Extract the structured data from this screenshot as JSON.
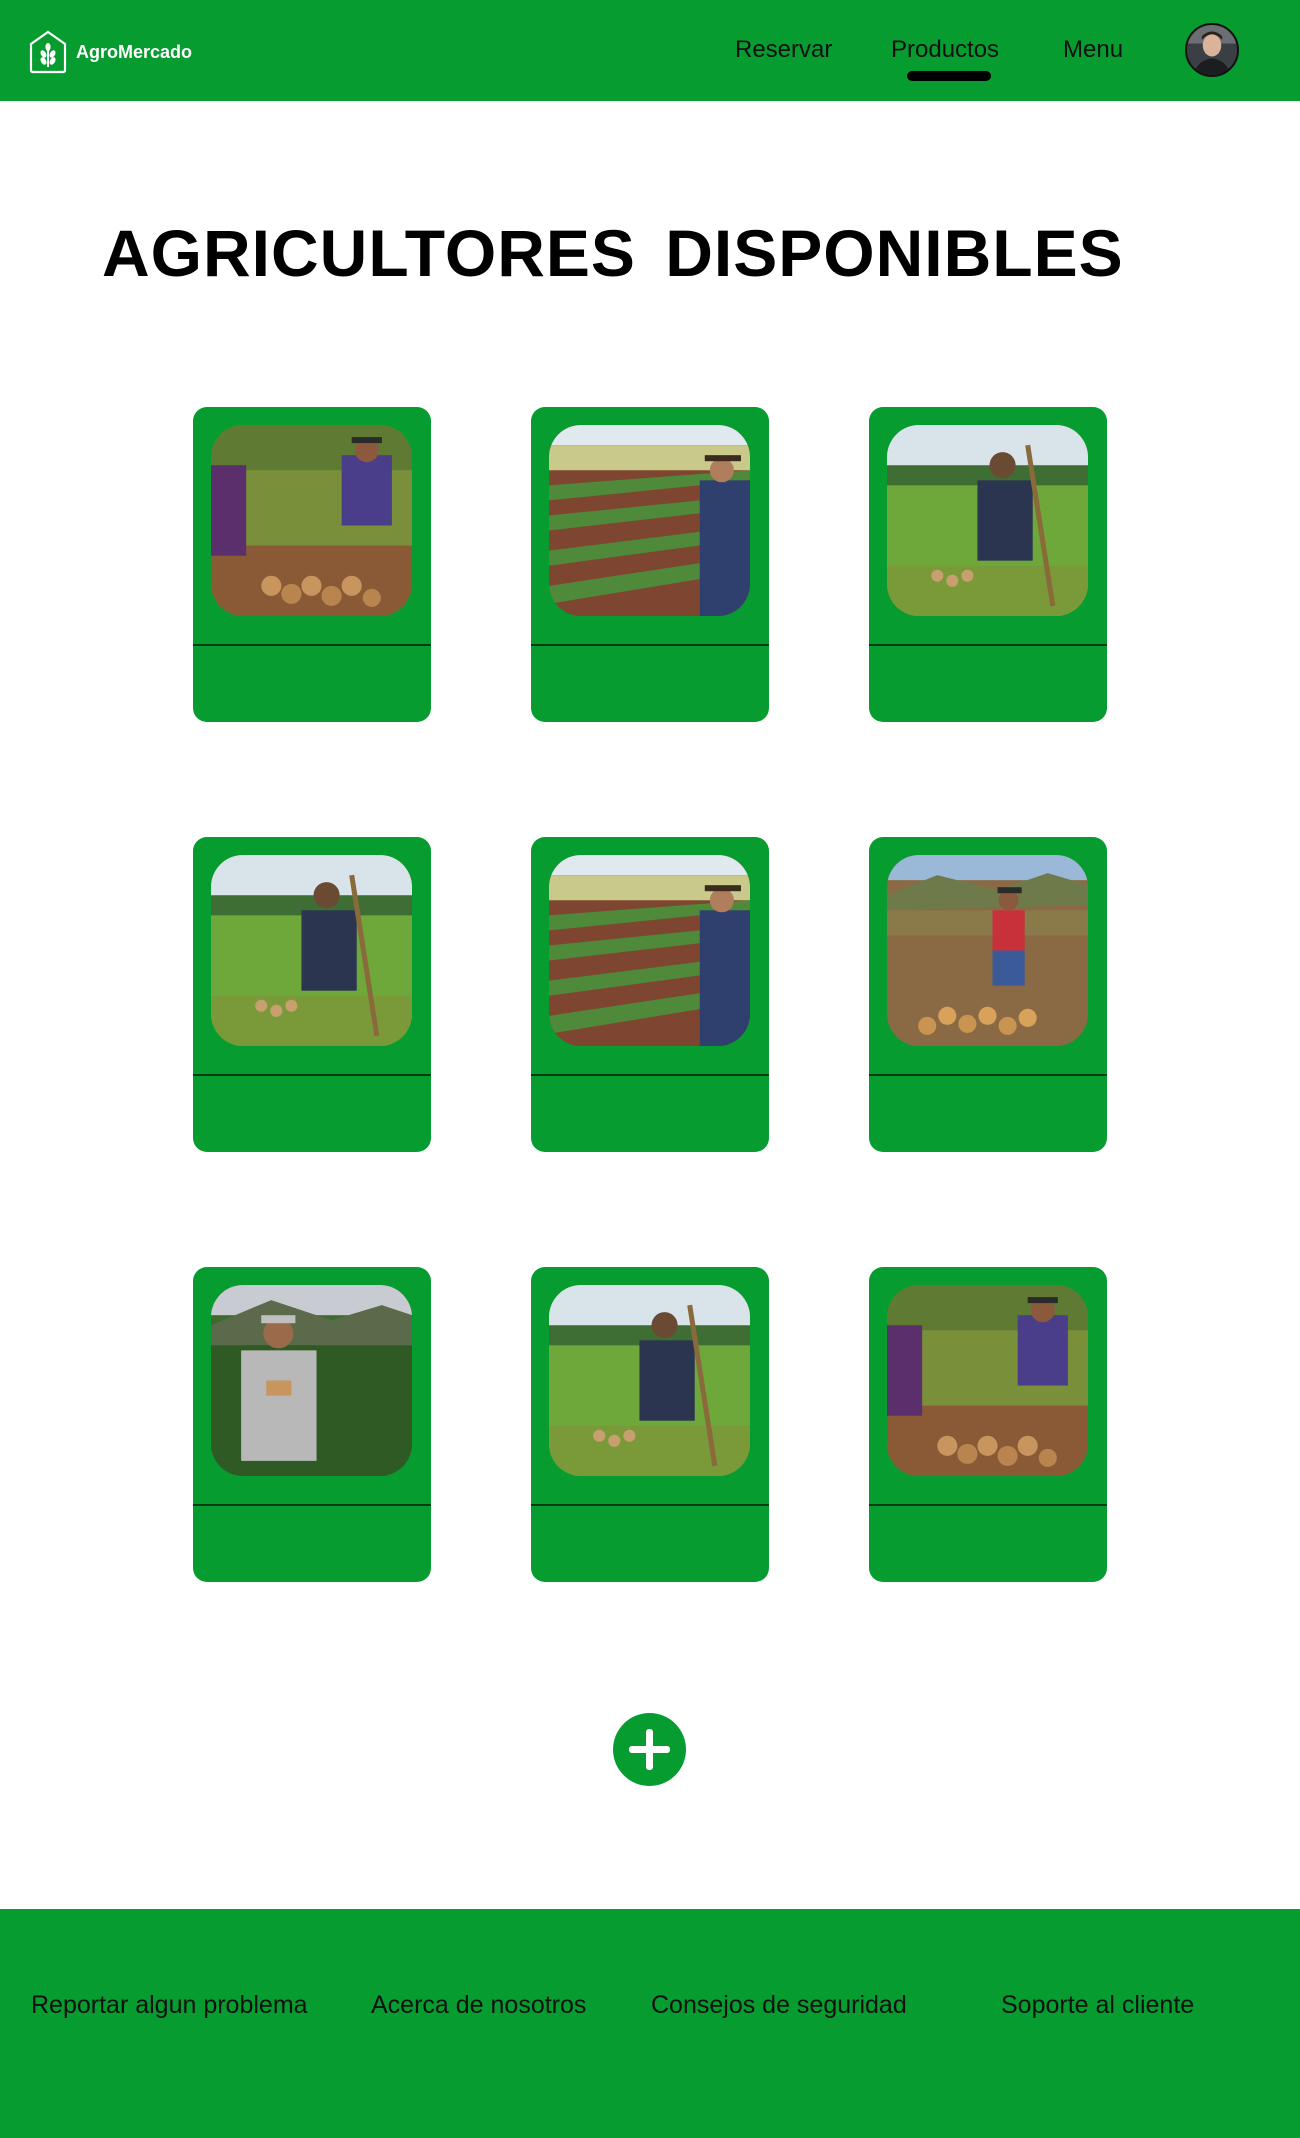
{
  "app": {
    "name": "AgroMercado",
    "logo_icon": "wheat-house-logo-icon"
  },
  "colors": {
    "brand_green": "#069c2f",
    "text": "#000000",
    "background": "#ffffff"
  },
  "nav": {
    "items": [
      {
        "label": "Reservar",
        "active": false
      },
      {
        "label": "Productos",
        "active": true
      },
      {
        "label": "Menu",
        "active": false
      }
    ],
    "avatar_icon": "user-avatar-icon"
  },
  "page": {
    "title": "AGRICULTORES DISPONIBLES"
  },
  "farmers": [
    {
      "photo": "farmers-harvesting-potatoes-photo"
    },
    {
      "photo": "farmer-in-potato-field-photo"
    },
    {
      "photo": "farmer-with-hoe-photo"
    },
    {
      "photo": "farmer-with-hoe-photo"
    },
    {
      "photo": "farmer-in-potato-field-photo"
    },
    {
      "photo": "farmer-woman-with-harvest-photo"
    },
    {
      "photo": "farmer-holding-potatoes-photo"
    },
    {
      "photo": "farmer-with-hoe-photo"
    },
    {
      "photo": "farmers-harvesting-potatoes-photo"
    }
  ],
  "add_button": {
    "icon": "plus-icon"
  },
  "footer": {
    "links": [
      "Reportar algun problema",
      "Acerca de nosotros",
      "Consejos de seguridad",
      "Soporte al cliente"
    ]
  }
}
